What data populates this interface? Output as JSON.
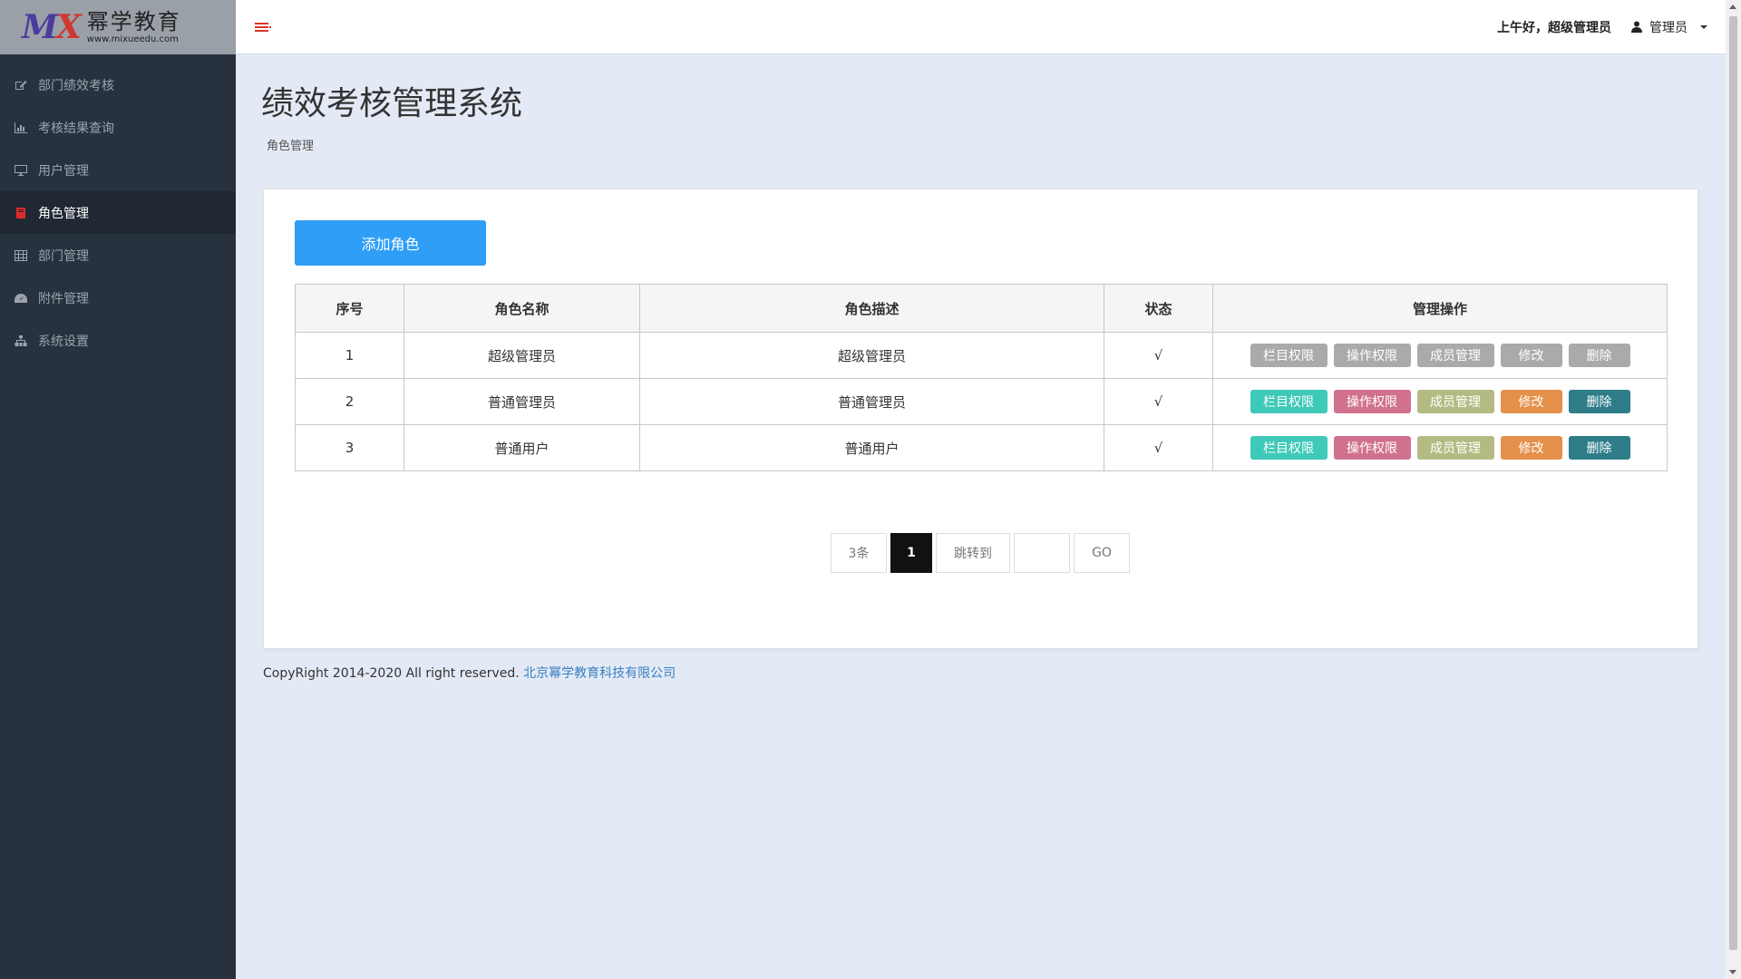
{
  "logo": {
    "mark": "MX",
    "name": "幂学教育",
    "url": "www.mixueedu.com"
  },
  "sidebar": {
    "items": [
      {
        "label": "部门绩效考核",
        "icon": "edit-icon"
      },
      {
        "label": "考核结果查询",
        "icon": "bar-chart-icon"
      },
      {
        "label": "用户管理",
        "icon": "monitor-icon"
      },
      {
        "label": "角色管理",
        "icon": "book-icon",
        "active": true
      },
      {
        "label": "部门管理",
        "icon": "table-icon"
      },
      {
        "label": "附件管理",
        "icon": "dashboard-icon"
      },
      {
        "label": "系统设置",
        "icon": "sitemap-icon"
      }
    ]
  },
  "topbar": {
    "greeting": "上午好，超级管理员",
    "user": "管理员"
  },
  "header": {
    "title": "绩效考核管理系统",
    "breadcrumb": "角色管理"
  },
  "toolbar": {
    "add_label": "添加角色"
  },
  "table": {
    "headers": [
      "序号",
      "角色名称",
      "角色描述",
      "状态",
      "管理操作"
    ],
    "rows": [
      {
        "index": "1",
        "name": "超级管理员",
        "desc": "超级管理员",
        "status": "√",
        "disabled": true
      },
      {
        "index": "2",
        "name": "普通管理员",
        "desc": "普通管理员",
        "status": "√",
        "disabled": false
      },
      {
        "index": "3",
        "name": "普通用户",
        "desc": "普通用户",
        "status": "√",
        "disabled": false
      }
    ],
    "actions": [
      "栏目权限",
      "操作权限",
      "成员管理",
      "修改",
      "删除"
    ]
  },
  "colors": {
    "column_perm": "#3fc9b9",
    "op_perm": "#d0728e",
    "member": "#b4bb82",
    "edit": "#e4904a",
    "delete": "#2e7d89",
    "disabled": "#aaaaaa",
    "primary": "#2f9ef6",
    "sidebar_bg": "#28323f"
  },
  "pagination": {
    "count": "3条",
    "current": "1",
    "jump_label": "跳转到",
    "input_value": "",
    "go_label": "GO"
  },
  "footer": {
    "text": "CopyRight 2014-2020 All right reserved. ",
    "company": "北京幂学教育科技有限公司"
  }
}
